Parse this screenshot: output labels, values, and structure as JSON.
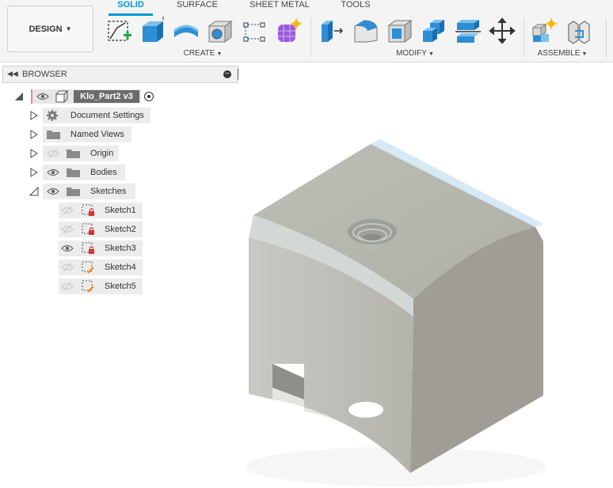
{
  "toolbar": {
    "design_label": "DESIGN",
    "tabs": [
      {
        "label": "SOLID",
        "active": true
      },
      {
        "label": "SURFACE",
        "active": false
      },
      {
        "label": "SHEET METAL",
        "active": false
      },
      {
        "label": "TOOLS",
        "active": false
      }
    ],
    "groups": {
      "create": "CREATE",
      "modify": "MODIFY",
      "assemble": "ASSEMBLE"
    },
    "accent_color": "#0696d7"
  },
  "browser": {
    "title": "BROWSER",
    "root": {
      "name": "Klo_Part2 v3"
    },
    "items": [
      {
        "label": "Document Settings",
        "icon": "gear-icon"
      },
      {
        "label": "Named Views",
        "icon": "folder-icon"
      },
      {
        "label": "Origin",
        "icon": "folder-icon",
        "visible": false
      },
      {
        "label": "Bodies",
        "icon": "folder-icon",
        "visible": true
      },
      {
        "label": "Sketches",
        "icon": "folder-icon",
        "visible": true,
        "expanded": true
      }
    ],
    "sketches": [
      {
        "label": "Sketch1",
        "visible": false
      },
      {
        "label": "Sketch2",
        "visible": false
      },
      {
        "label": "Sketch3",
        "visible": true
      },
      {
        "label": "Sketch4",
        "visible": false
      },
      {
        "label": "Sketch5",
        "visible": false
      }
    ]
  }
}
